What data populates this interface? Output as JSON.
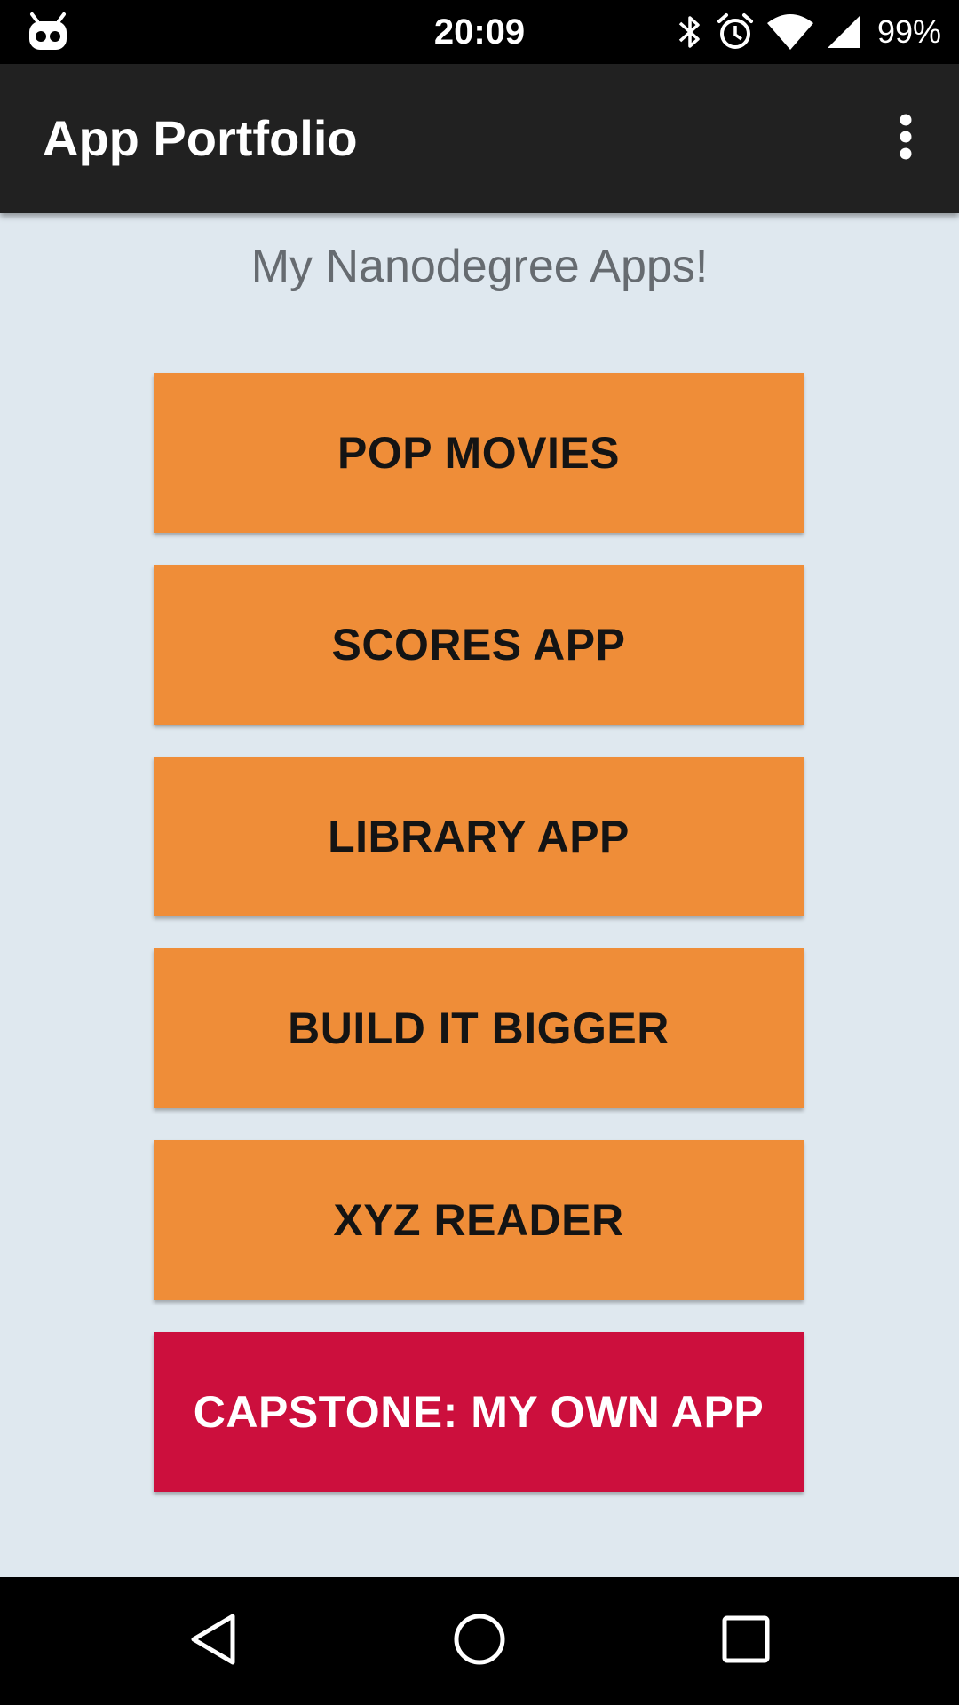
{
  "status_bar": {
    "time": "20:09",
    "battery": "99%",
    "icons": [
      "notification-icon",
      "bluetooth-icon",
      "alarm-icon",
      "wifi-icon",
      "signal-icon"
    ]
  },
  "app_bar": {
    "title": "App Portfolio",
    "menu_icon": "more-vert-icon"
  },
  "main": {
    "heading": "My Nanodegree Apps!",
    "buttons": [
      {
        "label": "POP MOVIES",
        "color": "#ef8d38"
      },
      {
        "label": "SCORES APP",
        "color": "#ef8d38"
      },
      {
        "label": "LIBRARY APP",
        "color": "#ef8d38"
      },
      {
        "label": "BUILD IT BIGGER",
        "color": "#ef8d38"
      },
      {
        "label": "XYZ READER",
        "color": "#ef8d38"
      },
      {
        "label": "CAPSTONE: MY OWN APP",
        "color": "#cc0f3d"
      }
    ]
  },
  "nav_bar": {
    "icons": [
      "back-icon",
      "home-icon",
      "recents-icon"
    ]
  }
}
